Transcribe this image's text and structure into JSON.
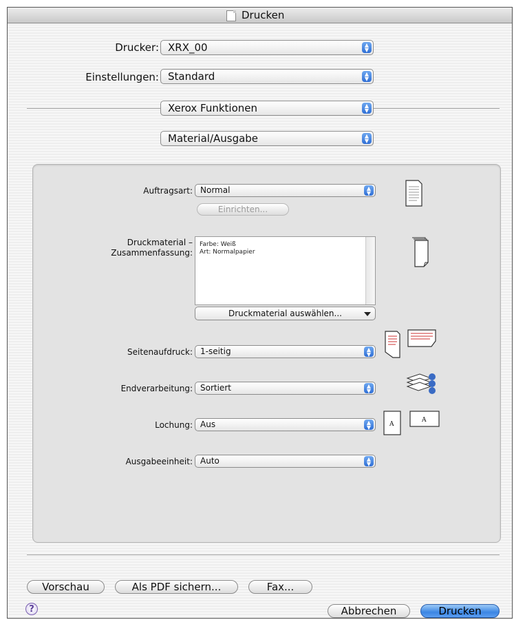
{
  "window": {
    "title": "Drucken"
  },
  "top": {
    "printer_label": "Drucker:",
    "printer_value": "XRX_00",
    "presets_label": "Einstellungen:",
    "presets_value": "Standard",
    "features_value": "Xerox Funktionen",
    "section_value": "Material/Ausgabe"
  },
  "panel": {
    "job_type_label": "Auftragsart:",
    "job_type_value": "Normal",
    "setup_button": "Einrichten...",
    "paper_label_line1": "Druckmaterial –",
    "paper_label_line2": "Zusammenfassung:",
    "paper_summary_lines": [
      "Farbe: Weiß",
      "Art: Normalpapier"
    ],
    "select_paper_button": "Druckmaterial auswählen...",
    "sides_label": "Seitenaufdruck:",
    "sides_value": "1-seitig",
    "finishing_label": "Endverarbeitung:",
    "finishing_value": "Sortiert",
    "punch_label": "Lochung:",
    "punch_value": "Aus",
    "output_label": "Ausgabeeinheit:",
    "output_value": "Auto"
  },
  "footer": {
    "preview_button": "Vorschau",
    "save_pdf_button": "Als PDF sichern...",
    "fax_button": "Fax...",
    "help_glyph": "?",
    "cancel_button": "Abbrechen",
    "print_button": "Drucken"
  }
}
